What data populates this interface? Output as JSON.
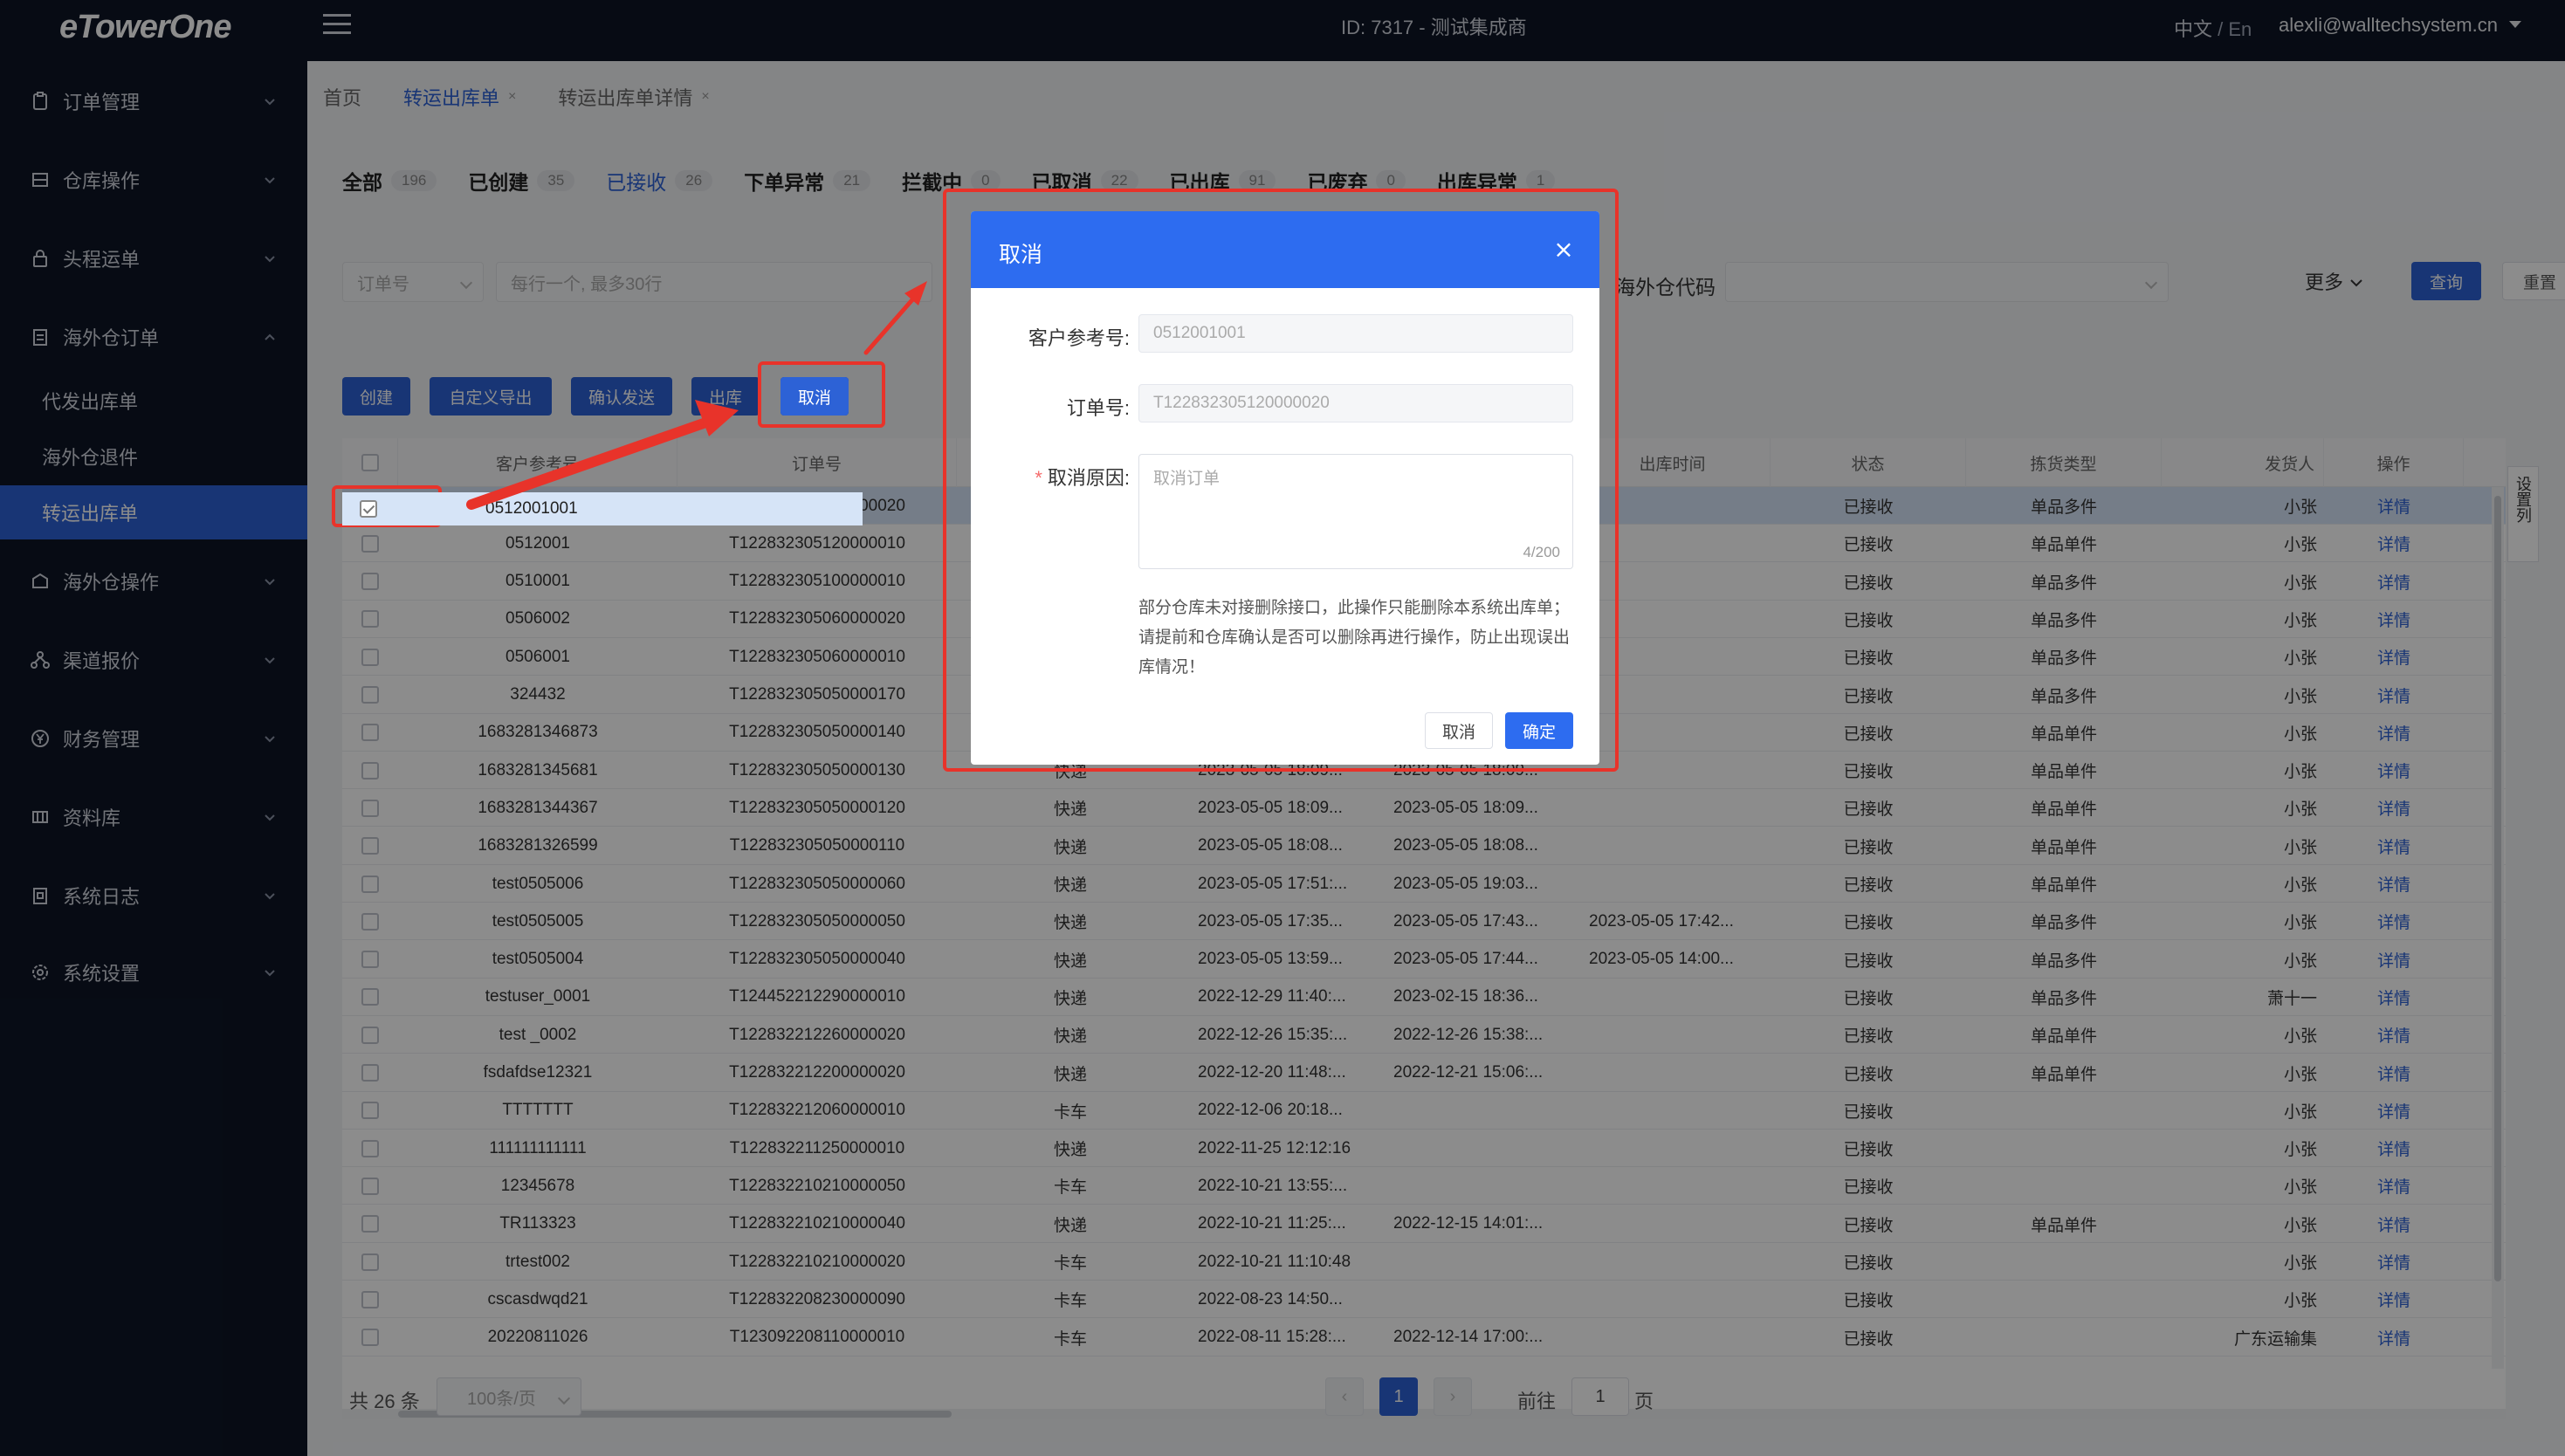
{
  "app": {
    "logo": "eTowerOne",
    "title": "ID: 7317 - 测试集成商",
    "lang_cn": "中文",
    "lang_sep": " / ",
    "lang_en": "En",
    "user_email": "alexli@walltechsystem.cn"
  },
  "sidebar": {
    "items": [
      {
        "label": "订单管理",
        "icon": "clipboard-icon"
      },
      {
        "label": "仓库操作",
        "icon": "warehouse-icon"
      },
      {
        "label": "头程运单",
        "icon": "lock-icon"
      },
      {
        "label": "海外仓订单",
        "icon": "document-icon"
      },
      {
        "label": "海外仓操作",
        "icon": "box-icon"
      },
      {
        "label": "渠道报价",
        "icon": "network-icon"
      },
      {
        "label": "财务管理",
        "icon": "yen-icon"
      },
      {
        "label": "资料库",
        "icon": "database-icon"
      },
      {
        "label": "系统日志",
        "icon": "log-icon"
      },
      {
        "label": "系统设置",
        "icon": "gear-icon"
      }
    ],
    "subitems": [
      "代发出库单",
      "海外仓退件",
      "转运出库单"
    ]
  },
  "page_tabs": [
    {
      "label": "首页"
    },
    {
      "label": "转运出库单",
      "close": "×"
    },
    {
      "label": "转运出库单详情",
      "close": "×"
    }
  ],
  "status_tabs": [
    {
      "label": "全部",
      "count": "196"
    },
    {
      "label": "已创建",
      "count": "35"
    },
    {
      "label": "已接收",
      "count": "26"
    },
    {
      "label": "下单异常",
      "count": "21"
    },
    {
      "label": "拦截中",
      "count": "0"
    },
    {
      "label": "已取消",
      "count": "22"
    },
    {
      "label": "已出库",
      "count": "91"
    },
    {
      "label": "已废弃",
      "count": "0"
    },
    {
      "label": "出库异常",
      "count": "1"
    }
  ],
  "filters": {
    "field_select": "订单号",
    "search_placeholder": "每行一个, 最多30行",
    "warehouse_code_label": "海外仓代码",
    "more": "更多",
    "query": "查询",
    "reset": "重置"
  },
  "toolbar": {
    "create": "创建",
    "custom_export": "自定义导出",
    "confirm_send": "确认发送",
    "outbound": "出库",
    "cancel": "取消"
  },
  "table": {
    "headers": {
      "ref": "客户参考号",
      "order_no": "订单号",
      "outbound_time": "出库时间",
      "status": "状态",
      "pick_type": "拣货类型",
      "sender": "发货人",
      "action": "操作"
    },
    "settings_col": "设置列",
    "rows": [
      {
        "ref": "0512001001",
        "order_no": "T122832305120000020",
        "channel": "",
        "create_time": "",
        "update_time": "",
        "outbound_time": "",
        "status": "已接收",
        "pick_type": "单品多件",
        "sender": "小张",
        "action": "详情"
      },
      {
        "ref": "0512001",
        "order_no": "T122832305120000010",
        "channel": "",
        "create_time": "",
        "update_time": "",
        "outbound_time": "",
        "status": "已接收",
        "pick_type": "单品单件",
        "sender": "小张",
        "action": "详情"
      },
      {
        "ref": "0510001",
        "order_no": "T122832305100000010",
        "channel": "",
        "create_time": "",
        "update_time": "",
        "outbound_time": "",
        "status": "已接收",
        "pick_type": "单品多件",
        "sender": "小张",
        "action": "详情"
      },
      {
        "ref": "0506002",
        "order_no": "T122832305060000020",
        "channel": "",
        "create_time": "",
        "update_time": "",
        "outbound_time": "",
        "status": "已接收",
        "pick_type": "单品多件",
        "sender": "小张",
        "action": "详情"
      },
      {
        "ref": "0506001",
        "order_no": "T122832305060000010",
        "channel": "",
        "create_time": "",
        "update_time": "",
        "outbound_time": "",
        "status": "已接收",
        "pick_type": "单品多件",
        "sender": "小张",
        "action": "详情"
      },
      {
        "ref": "324432",
        "order_no": "T122832305050000170",
        "channel": "",
        "create_time": "",
        "update_time": "",
        "outbound_time": "",
        "status": "已接收",
        "pick_type": "单品多件",
        "sender": "小张",
        "action": "详情"
      },
      {
        "ref": "1683281346873",
        "order_no": "T122832305050000140",
        "channel": "",
        "create_time": "",
        "update_time": "",
        "outbound_time": "",
        "status": "已接收",
        "pick_type": "单品单件",
        "sender": "小张",
        "action": "详情"
      },
      {
        "ref": "1683281345681",
        "order_no": "T122832305050000130",
        "channel": "快递",
        "create_time": "2023-05-05 18:09...",
        "update_time": "2023-05-05 18:09...",
        "outbound_time": "",
        "status": "已接收",
        "pick_type": "单品单件",
        "sender": "小张",
        "action": "详情"
      },
      {
        "ref": "1683281344367",
        "order_no": "T122832305050000120",
        "channel": "快递",
        "create_time": "2023-05-05 18:09...",
        "update_time": "2023-05-05 18:09...",
        "outbound_time": "",
        "status": "已接收",
        "pick_type": "单品单件",
        "sender": "小张",
        "action": "详情"
      },
      {
        "ref": "1683281326599",
        "order_no": "T122832305050000110",
        "channel": "快递",
        "create_time": "2023-05-05 18:08...",
        "update_time": "2023-05-05 18:08...",
        "outbound_time": "",
        "status": "已接收",
        "pick_type": "单品单件",
        "sender": "小张",
        "action": "详情"
      },
      {
        "ref": "test0505006",
        "order_no": "T122832305050000060",
        "channel": "快递",
        "create_time": "2023-05-05 17:51:...",
        "update_time": "2023-05-05 19:03...",
        "outbound_time": "",
        "status": "已接收",
        "pick_type": "单品单件",
        "sender": "小张",
        "action": "详情"
      },
      {
        "ref": "test0505005",
        "order_no": "T122832305050000050",
        "channel": "快递",
        "create_time": "2023-05-05 17:35...",
        "update_time": "2023-05-05 17:43...",
        "outbound_time": "2023-05-05 17:42...",
        "status": "已接收",
        "pick_type": "单品多件",
        "sender": "小张",
        "action": "详情"
      },
      {
        "ref": "test0505004",
        "order_no": "T122832305050000040",
        "channel": "快递",
        "create_time": "2023-05-05 13:59...",
        "update_time": "2023-05-05 17:44...",
        "outbound_time": "2023-05-05 14:00...",
        "status": "已接收",
        "pick_type": "单品多件",
        "sender": "小张",
        "action": "详情"
      },
      {
        "ref": "testuser_0001",
        "order_no": "T124452212290000010",
        "channel": "快递",
        "create_time": "2022-12-29 11:40:...",
        "update_time": "2023-02-15 18:36...",
        "outbound_time": "",
        "status": "已接收",
        "pick_type": "单品多件",
        "sender": "萧十一",
        "action": "详情"
      },
      {
        "ref": "test _0002",
        "order_no": "T122832212260000020",
        "channel": "快递",
        "create_time": "2022-12-26 15:35:...",
        "update_time": "2022-12-26 15:38:...",
        "outbound_time": "",
        "status": "已接收",
        "pick_type": "单品单件",
        "sender": "小张",
        "action": "详情"
      },
      {
        "ref": "fsdafdse12321",
        "order_no": "T122832212200000020",
        "channel": "快递",
        "create_time": "2022-12-20 11:48:...",
        "update_time": "2022-12-21 15:06:...",
        "outbound_time": "",
        "status": "已接收",
        "pick_type": "单品单件",
        "sender": "小张",
        "action": "详情"
      },
      {
        "ref": "TTTTTTT",
        "order_no": "T122832212060000010",
        "channel": "卡车",
        "create_time": "2022-12-06 20:18...",
        "update_time": "",
        "outbound_time": "",
        "status": "已接收",
        "pick_type": "",
        "sender": "小张",
        "action": "详情"
      },
      {
        "ref": "111111111111",
        "order_no": "T122832211250000010",
        "channel": "快递",
        "create_time": "2022-11-25 12:12:16",
        "update_time": "",
        "outbound_time": "",
        "status": "已接收",
        "pick_type": "",
        "sender": "小张",
        "action": "详情"
      },
      {
        "ref": "12345678",
        "order_no": "T122832210210000050",
        "channel": "卡车",
        "create_time": "2022-10-21 13:55:...",
        "update_time": "",
        "outbound_time": "",
        "status": "已接收",
        "pick_type": "",
        "sender": "小张",
        "action": "详情"
      },
      {
        "ref": "TR113323",
        "order_no": "T122832210210000040",
        "channel": "快递",
        "create_time": "2022-10-21 11:25:...",
        "update_time": "2022-12-15 14:01:...",
        "outbound_time": "",
        "status": "已接收",
        "pick_type": "单品单件",
        "sender": "小张",
        "action": "详情"
      },
      {
        "ref": "trtest002",
        "order_no": "T122832210210000020",
        "channel": "卡车",
        "create_time": "2022-10-21 11:10:48",
        "update_time": "",
        "outbound_time": "",
        "status": "已接收",
        "pick_type": "",
        "sender": "小张",
        "action": "详情"
      },
      {
        "ref": "cscasdwqd21",
        "order_no": "T122832208230000090",
        "channel": "卡车",
        "create_time": "2022-08-23 14:50...",
        "update_time": "",
        "outbound_time": "",
        "status": "已接收",
        "pick_type": "",
        "sender": "小张",
        "action": "详情"
      },
      {
        "ref": "20220811026",
        "order_no": "T123092208110000010",
        "channel": "卡车",
        "create_time": "2022-08-11 15:28:...",
        "update_time": "2022-12-14 17:00:...",
        "outbound_time": "",
        "status": "已接收",
        "pick_type": "",
        "sender": "广东运输集",
        "action": "详情"
      }
    ]
  },
  "pagination": {
    "total": "共 26 条",
    "page_size": "100条/页",
    "prev": "‹",
    "current": "1",
    "next": "›",
    "goto_label": "前往",
    "goto_value": "1",
    "goto_suffix": "页"
  },
  "modal": {
    "title": "取消",
    "close": "×",
    "ref_label": "客户参考号:",
    "ref_value": "0512001001",
    "order_label": "订单号:",
    "order_value": "T122832305120000020",
    "reason_required": "*",
    "reason_label": "取消原因:",
    "reason_value": "取消订单",
    "reason_count": "4/200",
    "note": "部分仓库未对接删除接口，此操作只能删除本系统出库单；请提前和仓库确认是否可以删除再进行操作，防止出现误出库情况！",
    "cancel": "取消",
    "confirm": "确定"
  },
  "colors": {
    "primary": "#2d62d6",
    "sidebar_bg": "#0d1526",
    "annotation_red": "#e8332a",
    "modal_header": "#2d6cf0"
  }
}
